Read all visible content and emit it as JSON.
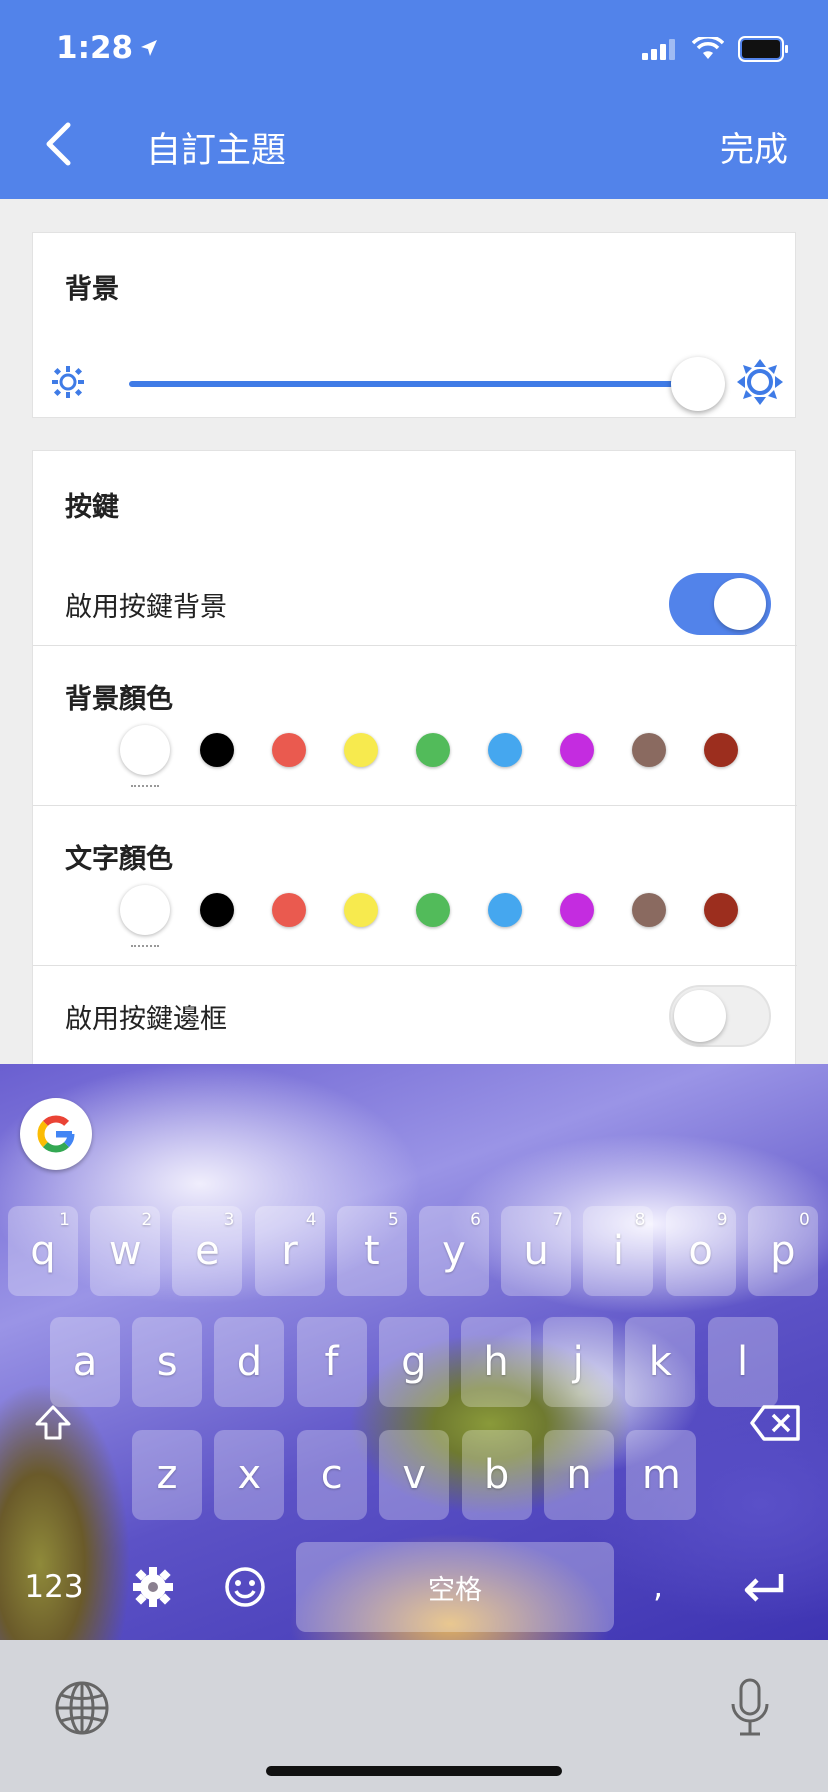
{
  "status_bar": {
    "time": "1:28"
  },
  "header": {
    "title": "自訂主題",
    "done_label": "完成"
  },
  "background_section": {
    "title": "背景",
    "brightness_level": 0.95
  },
  "keys_section": {
    "title": "按鍵",
    "enable_key_background": {
      "label": "啟用按鍵背景",
      "on": true
    },
    "key_background_color": {
      "label": "背景顏色",
      "selected": "#ffffff"
    },
    "text_color": {
      "label": "文字顏色",
      "selected": "#ffffff"
    },
    "enable_key_border": {
      "label": "啟用按鍵邊框",
      "on": false
    },
    "palette": [
      "#ffffff",
      "#000000",
      "#ea5a4f",
      "#f7ea4e",
      "#52bb5a",
      "#45a7ef",
      "#c42ce0",
      "#8a6a60",
      "#9c2e1e",
      "#e58a2a"
    ]
  },
  "keyboard": {
    "row1": [
      {
        "key": "q",
        "hint": "1"
      },
      {
        "key": "w",
        "hint": "2"
      },
      {
        "key": "e",
        "hint": "3"
      },
      {
        "key": "r",
        "hint": "4"
      },
      {
        "key": "t",
        "hint": "5"
      },
      {
        "key": "y",
        "hint": "6"
      },
      {
        "key": "u",
        "hint": "7"
      },
      {
        "key": "i",
        "hint": "8"
      },
      {
        "key": "o",
        "hint": "9"
      },
      {
        "key": "p",
        "hint": "0"
      }
    ],
    "row2": [
      "a",
      "s",
      "d",
      "f",
      "g",
      "h",
      "j",
      "k",
      "l"
    ],
    "row3": [
      "z",
      "x",
      "c",
      "v",
      "b",
      "n",
      "m"
    ],
    "numbers_key": "123",
    "space_label": "空格",
    "comma_key": ","
  }
}
